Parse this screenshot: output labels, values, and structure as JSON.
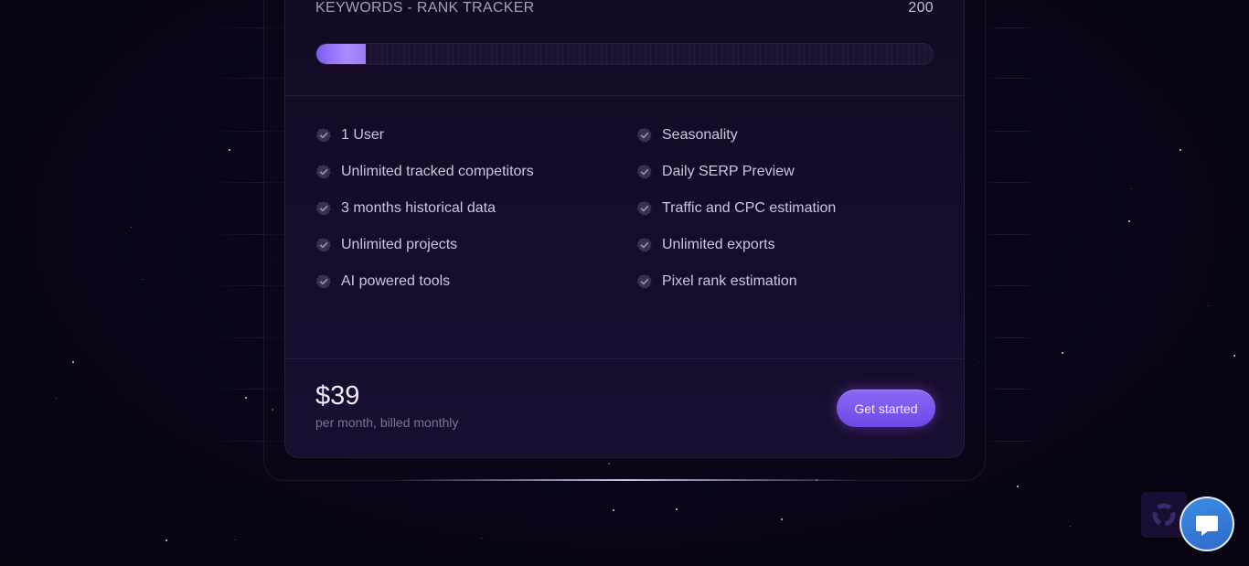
{
  "plan": {
    "metric_label": "KEYWORDS - RANK TRACKER",
    "metric_value": "200",
    "progress_fraction": 0.08,
    "features_left": [
      "1 User",
      "Unlimited tracked competitors",
      "3 months historical data",
      "Unlimited projects",
      "AI powered tools"
    ],
    "features_right": [
      "Seasonality",
      "Daily SERP Preview",
      "Traffic and CPC estimation",
      "Unlimited exports",
      "Pixel rank estimation"
    ],
    "price": "$39",
    "price_note": "per month, billed monthly",
    "cta_label": "Get started"
  },
  "icons": {
    "feature_check": "check-badge-icon",
    "chat": "chat-bubble-icon",
    "assistant": "spinner-logo-icon"
  },
  "colors": {
    "background": "#0a0416",
    "accent": "#7c5cf0",
    "chat": "#3a8de6"
  }
}
